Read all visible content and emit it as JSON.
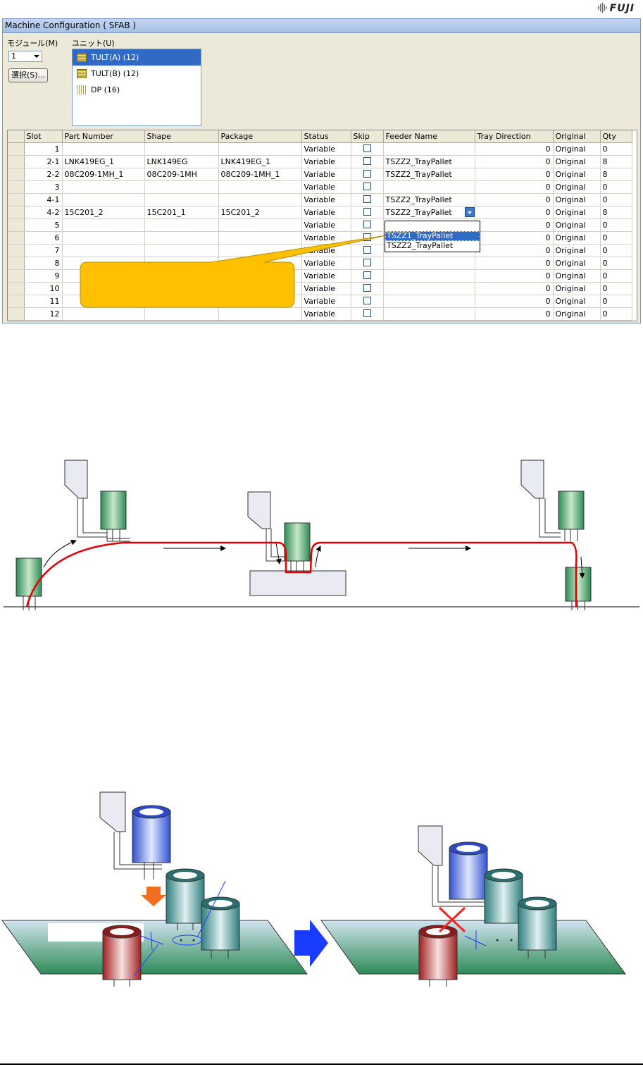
{
  "logo": "FUJI",
  "window": {
    "title": "Machine Configuration ( SFAB )"
  },
  "module": {
    "label": "モジュール(M)",
    "value": "1",
    "select_button": "選択(S)..."
  },
  "unit": {
    "label": "ユニット(U)",
    "items": [
      {
        "label": "TULT(A) (12)",
        "selected": true
      },
      {
        "label": "TULT(B) (12)",
        "selected": false
      },
      {
        "label": "DP (16)",
        "selected": false
      }
    ]
  },
  "grid": {
    "columns": [
      "Slot",
      "Part Number",
      "Shape",
      "Package",
      "Status",
      "Skip",
      "Feeder Name",
      "Tray Direction",
      "Original",
      "Qty"
    ],
    "rows": [
      [
        "1",
        "",
        "",
        "",
        "Variable",
        "",
        "",
        "0",
        "Original",
        "0"
      ],
      [
        "2-1",
        "LNK419EG_1",
        "LNK149EG",
        "LNK419EG_1",
        "Variable",
        "",
        "TSZZ2_TrayPallet",
        "0",
        "Original",
        "8"
      ],
      [
        "2-2",
        "08C209-1MH_1",
        "08C209-1MH",
        "08C209-1MH_1",
        "Variable",
        "",
        "TSZZ2_TrayPallet",
        "0",
        "Original",
        "8"
      ],
      [
        "3",
        "",
        "",
        "",
        "Variable",
        "",
        "",
        "0",
        "Original",
        "0"
      ],
      [
        "4-1",
        "",
        "",
        "",
        "Variable",
        "",
        "TSZZ2_TrayPallet",
        "0",
        "Original",
        "0"
      ],
      [
        "4-2",
        "15C201_2",
        "15C201_1",
        "15C201_2",
        "Variable",
        "",
        "TSZZ2_TrayPallet",
        "0",
        "Original",
        "8"
      ],
      [
        "5",
        "",
        "",
        "",
        "Variable",
        "",
        "",
        "0",
        "Original",
        "0"
      ],
      [
        "6",
        "",
        "",
        "",
        "Variable",
        "",
        "",
        "0",
        "Original",
        "0"
      ],
      [
        "7",
        "",
        "",
        "",
        "Variable",
        "",
        "",
        "0",
        "Original",
        "0"
      ],
      [
        "8",
        "",
        "",
        "",
        "Variable",
        "",
        "",
        "0",
        "Original",
        "0"
      ],
      [
        "9",
        "",
        "",
        "",
        "Variable",
        "",
        "",
        "0",
        "Original",
        "0"
      ],
      [
        "10",
        "",
        "",
        "",
        "Variable",
        "",
        "",
        "0",
        "Original",
        "0"
      ],
      [
        "11",
        "",
        "",
        "",
        "Variable",
        "",
        "",
        "0",
        "Original",
        "0"
      ],
      [
        "12",
        "",
        "",
        "",
        "Variable",
        "",
        "",
        "0",
        "Original",
        "0"
      ]
    ],
    "dropdown_options": [
      "",
      "TSZZ1_TrayPallet",
      "TSZZ2_TrayPallet"
    ]
  },
  "colors": {
    "callout": "#ffc000",
    "path_red": "#e00000",
    "board": "#2e8b57",
    "arrow_orange": "#f07020",
    "arrow_blue": "#1a3cff",
    "cross_red": "#ff2020"
  }
}
